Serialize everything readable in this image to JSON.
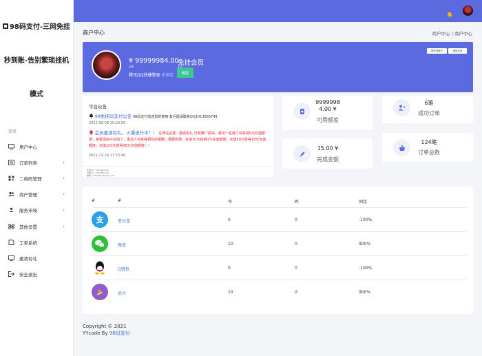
{
  "brand": {
    "line1": "98码支付-三网免挂",
    "line2": "秒到账-告别繁琐挂机",
    "line3": "模式"
  },
  "sidebar": {
    "caption": "菜单",
    "items": [
      {
        "label": "用户中心",
        "icon": "monitor-icon",
        "arrow": false
      },
      {
        "label": "订单列表",
        "icon": "list-icon",
        "arrow": true
      },
      {
        "label": "二维码管理",
        "icon": "qrcode-icon",
        "arrow": true
      },
      {
        "label": "商户管理",
        "icon": "users-icon",
        "arrow": true
      },
      {
        "label": "服务市场",
        "icon": "group-icon",
        "arrow": true
      },
      {
        "label": "其他设置",
        "icon": "command-icon",
        "arrow": true
      },
      {
        "label": "工单系统",
        "icon": "ticket-icon",
        "arrow": false
      },
      {
        "label": "邀请有礼",
        "icon": "monitor-icon",
        "arrow": false
      },
      {
        "label": "安全退出",
        "icon": "logout-icon",
        "arrow": false
      }
    ]
  },
  "header": {
    "title": "商户中心",
    "breadcrumb": "商户中心 / 商户中心"
  },
  "hero": {
    "balance": "¥ 99999984.00",
    "balance_sub": "余额",
    "member": "免挂会员",
    "member_sub": "会员",
    "qq_text": "腾讯QQ快捷登录",
    "qq_link": "未绑定",
    "bind_button": "绑定",
    "tag1": "提现到账户",
    "tag2": "提现记录"
  },
  "announce": {
    "title": "平台公告",
    "item1_link": "98免挂码支付公告",
    "item1_text": "98码支付欢迎您的使用,有问题请联系QQ1013665749",
    "item1_date": "2021-09-09 10:20:05",
    "item2_link": "会员邀请有礼，火爆进行中！！",
    "item2_text": "在网站设置 - 邀请有礼 分有推广获得，邀请一名用户可获得5元充值额度，被邀请用户充值了，邀请人可获得相应的报酬。报酬奖励：充值10元获得3元充值额度；充值50元获得18元充值额度；充值100元获得38元充值额度！！",
    "item2_date": "2021-11-14 17:13:49",
    "foot1": "充值QQ: 1013665749",
    "foot2": "问题QQ: 1013665749",
    "foot3": "邮箱: 1013665749@qq.com"
  },
  "stats": [
    {
      "value": "9999998\n4.00 ¥",
      "label": "可用额度",
      "icon": "wallet-icon"
    },
    {
      "value": "6笔",
      "label": "成功订单",
      "icon": "users-plus-icon"
    },
    {
      "value": "15.00 ¥",
      "label": "完成金额",
      "icon": "rocket-icon"
    },
    {
      "value": "124笔",
      "label": "订单总数",
      "icon": "basket-icon"
    }
  ],
  "table": {
    "headers": [
      "#",
      "#",
      "今",
      "昨",
      "同比"
    ],
    "rows": [
      {
        "icon": "alipay-icon",
        "name": "支付宝",
        "today": "0",
        "yesterday": "0",
        "ratio": "-100%"
      },
      {
        "icon": "wechat-icon",
        "name": "微信",
        "today": "10",
        "yesterday": "0",
        "ratio": "900%"
      },
      {
        "icon": "qq-icon",
        "name": "Q钱包",
        "today": "0",
        "yesterday": "0",
        "ratio": "-100%"
      },
      {
        "icon": "total-icon",
        "name": "总计",
        "today": "10",
        "yesterday": "0",
        "ratio": "900%"
      }
    ]
  },
  "footer": {
    "copyright": "Copyright © 2021",
    "code_by": "YYcode By",
    "code_link": "98码支付"
  },
  "colors": {
    "primary": "#5c6ae0",
    "link": "#3a6fd8",
    "alert": "#e23",
    "bind": "#3ec796"
  }
}
